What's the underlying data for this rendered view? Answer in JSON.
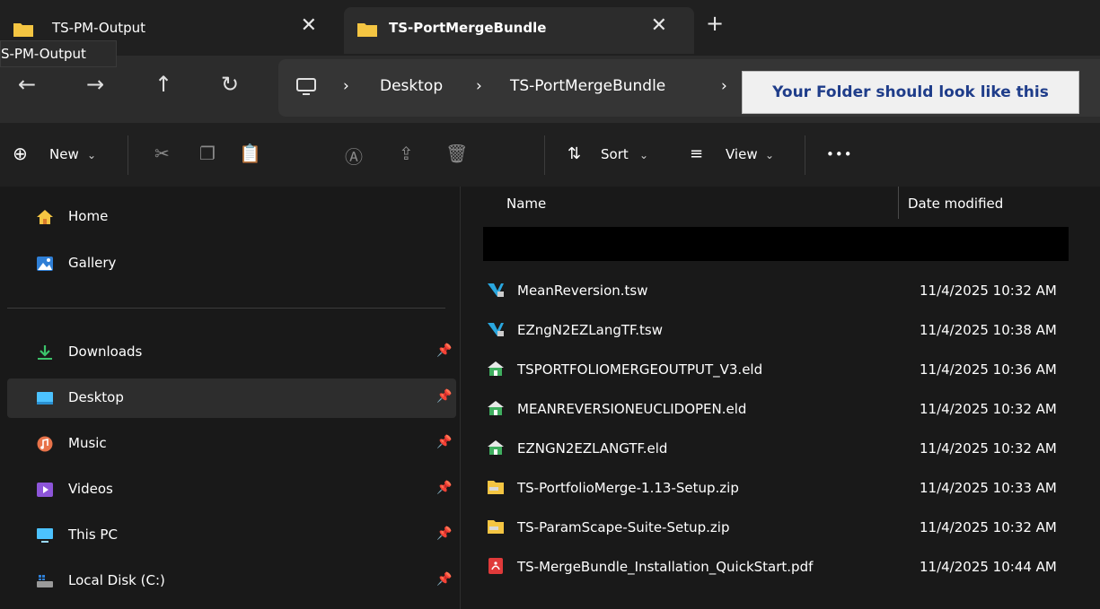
{
  "tabs": [
    {
      "label": "TS-PM-Output",
      "active": false
    },
    {
      "label": "TS-PortMergeBundle",
      "active": true
    }
  ],
  "tooltip": "S-PM-Output",
  "breadcrumb": [
    "Desktop",
    "TS-PortMergeBundle"
  ],
  "callout": "Your Folder should look like this",
  "toolbar": {
    "new_label": "New",
    "sort_label": "Sort",
    "view_label": "View",
    "more_label": "•••"
  },
  "sidebar": {
    "top": [
      {
        "label": "Home",
        "icon": "home-icon"
      },
      {
        "label": "Gallery",
        "icon": "gallery-icon"
      }
    ],
    "pinned": [
      {
        "label": "Downloads",
        "icon": "download-icon",
        "selected": false
      },
      {
        "label": "Desktop",
        "icon": "desktop-icon",
        "selected": true
      },
      {
        "label": "Music",
        "icon": "music-icon",
        "selected": false
      },
      {
        "label": "Videos",
        "icon": "video-icon",
        "selected": false
      },
      {
        "label": "This PC",
        "icon": "pc-icon",
        "selected": false
      },
      {
        "label": "Local Disk (C:)",
        "icon": "disk-icon",
        "selected": false
      }
    ]
  },
  "columns": {
    "name": "Name",
    "date": "Date modified"
  },
  "files": [
    {
      "name": "MeanReversion.tsw",
      "date": "11/4/2025 10:32 AM",
      "type": "tsw"
    },
    {
      "name": "EZngN2EZLangTF.tsw",
      "date": "11/4/2025 10:38 AM",
      "type": "tsw"
    },
    {
      "name": "TSPORTFOLIOMERGEOUTPUT_V3.eld",
      "date": "11/4/2025 10:36 AM",
      "type": "eld"
    },
    {
      "name": "MEANREVERSIONEUCLIDOPEN.eld",
      "date": "11/4/2025 10:32 AM",
      "type": "eld"
    },
    {
      "name": "EZNGN2EZLANGTF.eld",
      "date": "11/4/2025 10:32 AM",
      "type": "eld"
    },
    {
      "name": "TS-PortfolioMerge-1.13-Setup.zip",
      "date": "11/4/2025 10:33 AM",
      "type": "zip"
    },
    {
      "name": "TS-ParamScape-Suite-Setup.zip",
      "date": "11/4/2025 10:32 AM",
      "type": "zip"
    },
    {
      "name": "TS-MergeBundle_Installation_QuickStart.pdf",
      "date": "11/4/2025 10:44 AM",
      "type": "pdf"
    }
  ],
  "colors": {
    "folder": "#f4c542",
    "accent": "#4cc2ff",
    "selected_bg": "#2d2d2d"
  }
}
